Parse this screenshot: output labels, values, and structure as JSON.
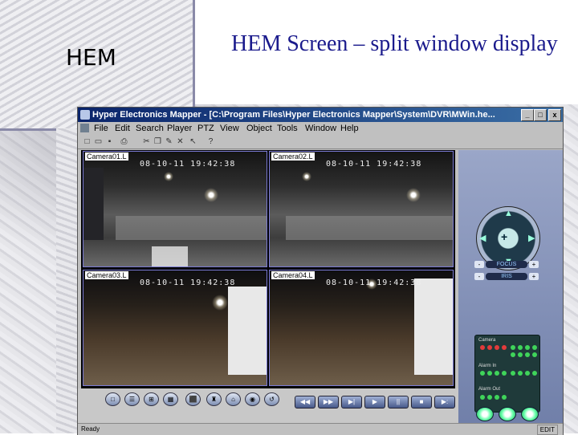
{
  "slide": {
    "left_title": "HEM",
    "title": "HEM Screen – split window display"
  },
  "window": {
    "title": "Hyper Electronics Mapper - [C:\\Program Files\\Hyper Electronics Mapper\\System\\DVR\\MWin.he...",
    "buttons": {
      "minimize": "_",
      "maximize": "□",
      "close": "x"
    }
  },
  "menubar": {
    "items": [
      "File",
      "Edit",
      "Search",
      "Player",
      "PTZ",
      "View",
      "Object",
      "Tools",
      "Window",
      "Help"
    ]
  },
  "toolbar": {
    "icons": [
      "new-icon",
      "open-icon",
      "save-icon",
      "print-icon",
      "cut-icon",
      "copy-icon",
      "paste-icon",
      "delete-icon",
      "pointer-icon",
      "help-icon"
    ],
    "glyphs": [
      "□",
      "▭",
      "▪",
      "⎙",
      "✂",
      "❐",
      "✎",
      "✕",
      "↖",
      "?"
    ]
  },
  "cameras": [
    {
      "label": "Camera01.L",
      "timestamp": "08-10-11  19:42:38"
    },
    {
      "label": "Camera02.L",
      "timestamp": "08-10-11  19:42:38"
    },
    {
      "label": "Camera03.L",
      "timestamp": "08-10-11  19:42:38"
    },
    {
      "label": "Camera04.L",
      "timestamp": "08-10-11  19:42:38"
    }
  ],
  "layout_buttons": [
    "□",
    "☰",
    "⊞",
    "▦",
    "⬛",
    "♜",
    "⌂",
    "◉",
    "↺"
  ],
  "playback_buttons": [
    "◀◀",
    "▶▶",
    "▶|",
    "▶",
    "||",
    "■",
    "▶:"
  ],
  "ptz_panel": {
    "center": "+",
    "focus_label": "FOCUS",
    "iris_label": "IRIS",
    "minus": "-",
    "plus": "+",
    "alarm_panel": {
      "camera_label": "Camera",
      "alarm_in_label": "Alarm In",
      "alarm_out_label": "Alarm Out"
    }
  },
  "statusbar": {
    "ready": "Ready",
    "mode": "EDIT"
  },
  "colors": {
    "title_text": "#1a1a8c",
    "titlebar_start": "#0a246a",
    "titlebar_end": "#3a6ea5",
    "window_chrome": "#c0c0c0",
    "camera_border": "#7b7bd6",
    "led_red": "#e23b3b",
    "led_green": "#3fd45a"
  }
}
